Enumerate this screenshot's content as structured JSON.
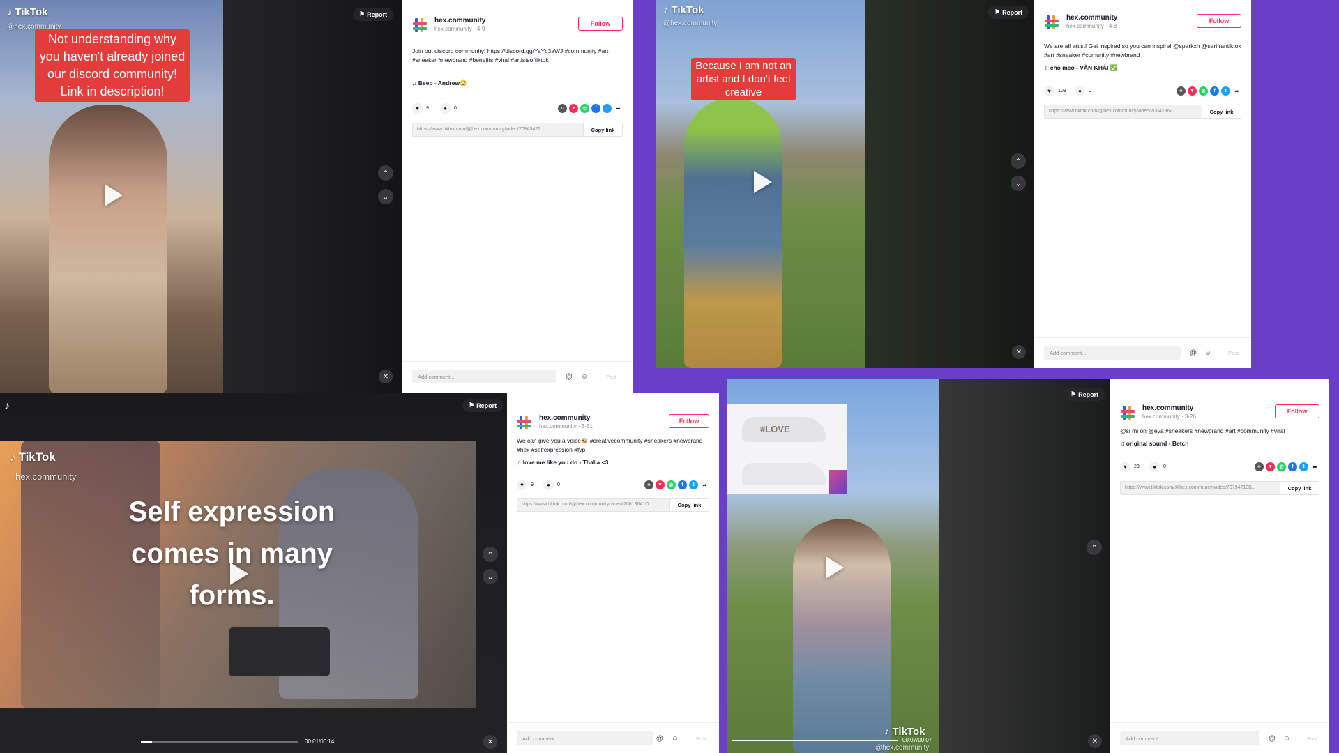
{
  "colors": {
    "background": "#6a3fc8",
    "follow": "#fe2c55",
    "caption": "#e43b3b"
  },
  "common": {
    "report": "Report",
    "follow": "Follow",
    "copy_link": "Copy link",
    "add_comment": "Add comment...",
    "post": "Post",
    "tiktok": "TikTok",
    "handle": "@hex.community"
  },
  "post1": {
    "caption": "Not understanding why you haven't already joined our discord community! Link in description!",
    "username": "hex.community",
    "meta": "hex.community · 4-9",
    "description": "Join out discord community! https://discord.gg/YaYc3aWJ #community #art #sneaker #newbrand #benefits #viral #artistsoftiktok",
    "music": "Beep - Andrew😳",
    "likes": "9",
    "comments": "0",
    "url": "https://www.tiktok.com/@hex.community/video/70845422..."
  },
  "post2": {
    "caption": "Because I am not an artist and I don't feel creative",
    "username": "hex.community",
    "meta": "hex.community · 4-8",
    "description": "We are all artist! Get inspired so you can inspire! @sparkxh @sarifrantiktok #art #sneaker #comunity #newbrand",
    "music": "cho meo - VĂN KHẢI ✅",
    "likes": "109",
    "comments": "0",
    "url": "https://www.tiktok.com/@hex.community/video/70842362..."
  },
  "post3": {
    "big_text": "Self expression comes in many forms.",
    "handle": "hex.community",
    "username": "hex.community",
    "meta": "hex.community · 3-31",
    "description": "We can give you a voice🐝 #creativecommunity #sneakers #newbrand #hex #selfexpression #fyp",
    "music": "love me like you do - Thalia <3",
    "likes": "9",
    "comments": "0",
    "url": "https://www.tiktok.com/@hex.community/video/70813641O...",
    "time": "00:01/00:14",
    "progress": 0.07
  },
  "post4": {
    "inset_text": "#LOVE",
    "username": "hex.community",
    "meta": "hex.community · 3-26",
    "description": "@si mi on @eva #sneakers #newbrand #art #community #viral",
    "music": "original sound - Betch",
    "likes": "23",
    "comments": "0",
    "url": "https://www.tiktok.com/@hex.community/video/70794710B...",
    "time": "00:07/00:07",
    "progress": 1.0
  },
  "icons": [
    "tiktok-logo-icon",
    "flag-icon",
    "play-icon",
    "chevron-up-icon",
    "chevron-down-icon",
    "mute-icon",
    "heart-icon",
    "comment-icon",
    "music-note-icon",
    "at-icon",
    "emoji-icon",
    "embed-icon",
    "whatsapp-icon",
    "facebook-icon",
    "twitter-icon",
    "share-arrow-icon"
  ]
}
